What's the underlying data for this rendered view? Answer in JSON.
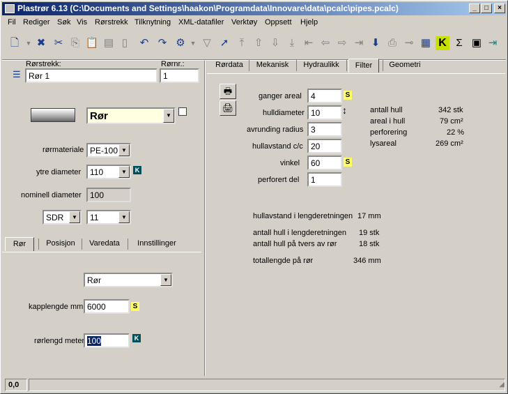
{
  "window": {
    "title": "Plastrør 6.13  (C:\\Documents and Settings\\haakon\\Programdata\\Innovare\\data\\pcalc\\pipes.pcalc)"
  },
  "menu": [
    "Fil",
    "Rediger",
    "Søk",
    "Vis",
    "Rørstrekk",
    "Tilknytning",
    "XML-datafiler",
    "Verktøy",
    "Oppsett",
    "Hjelp"
  ],
  "left": {
    "rorstrekk_label": "Rørstrekk:",
    "rorstrekk_value": "Rør 1",
    "rornr_label": "Rørnr.:",
    "rornr_value": "1",
    "type_value": "Rør",
    "rormateriale_label": "rørmateriale",
    "rormateriale_value": "PE-100",
    "ytre_label": "ytre diameter",
    "ytre_value": "110",
    "nominell_label": "nominell diameter",
    "nominell_value": "100",
    "sdr_label": "SDR",
    "sdr_value": "11",
    "tabs": [
      "Rør",
      "Posisjon",
      "Varedata",
      "Innstillinger"
    ],
    "ror_select": "Rør",
    "kapp_label": "kapplengde mm:",
    "kapp_value": "6000",
    "rorlengd_label": "rørlengd meter:",
    "rorlengd_value": "100"
  },
  "right": {
    "tabs": [
      "Rørdata",
      "Mekanisk",
      "Hydraulikk",
      "Filter",
      "Geometri"
    ],
    "fields": [
      {
        "label": "ganger areal",
        "value": "4"
      },
      {
        "label": "hulldiameter",
        "value": "10"
      },
      {
        "label": "avrunding radius",
        "value": "3"
      },
      {
        "label": "hullavstand c/c",
        "value": "20"
      },
      {
        "label": "vinkel",
        "value": "60"
      },
      {
        "label": "perforert del",
        "value": "1"
      }
    ],
    "results": [
      {
        "label": "antall hull",
        "value": "342 stk"
      },
      {
        "label": "areal i hull",
        "value": "79 cm²"
      },
      {
        "label": "perforering",
        "value": "22 %"
      },
      {
        "label": "lysareal",
        "value": "269 cm²"
      }
    ],
    "bottom": [
      {
        "label": "hullavstand i lengderetningen",
        "value": "17 mm"
      },
      {
        "label": "antall hull i lengderetningen",
        "value": "19 stk"
      },
      {
        "label": "antall hull på tvers av rør",
        "value": "18 stk"
      },
      {
        "label": "totallengde på rør",
        "value": "346 mm"
      }
    ]
  },
  "status": {
    "coords": "0,0"
  },
  "badges": {
    "s": "S",
    "k": "K"
  },
  "colors": {
    "title_start": "#0a246a",
    "title_end": "#a6caf0",
    "type_field": "#ffffe1"
  }
}
